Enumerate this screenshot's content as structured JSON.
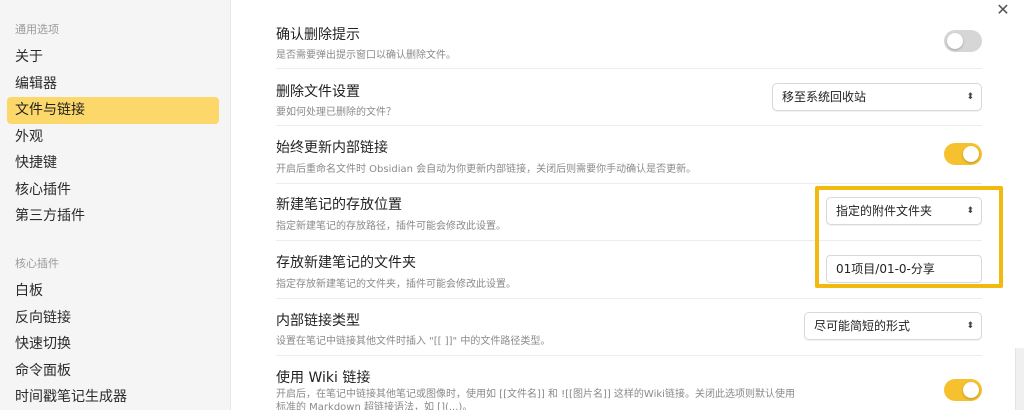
{
  "sidebar": {
    "general_title": "通用选项",
    "general_items": [
      "关于",
      "编辑器",
      "文件与链接",
      "外观",
      "快捷键",
      "核心插件",
      "第三方插件"
    ],
    "active_index": 2,
    "core_title": "核心插件",
    "core_items": [
      "白板",
      "反向链接",
      "快速切换",
      "命令面板",
      "时间戳笔记生成器"
    ]
  },
  "close_icon": "close-icon",
  "settings": [
    {
      "title": "确认删除提示",
      "desc": "是否需要弹出提示窗口以确认删除文件。",
      "control": "toggle",
      "on": false
    },
    {
      "title": "删除文件设置",
      "desc": "要如何处理已删除的文件？",
      "control": "select",
      "value": "移至系统回收站"
    },
    {
      "title": "始终更新内部链接",
      "desc": "开启后重命名文件时 Obsidian 会自动为你更新内部链接，关闭后则需要你手动确认是否更新。",
      "control": "toggle",
      "on": true
    },
    {
      "title": "新建笔记的存放位置",
      "desc": "指定新建笔记的存放路径，插件可能会修改此设置。",
      "control": "select",
      "value": "指定的附件文件夹"
    },
    {
      "title": "存放新建笔记的文件夹",
      "desc": "指定存放新建笔记的文件夹，插件可能会修改此设置。",
      "control": "text",
      "value": "01项目/01-0-分享"
    },
    {
      "title": "内部链接类型",
      "desc": "设置在笔记中链接其他文件时插入 \"[[ ]]\" 中的文件路径类型。",
      "control": "select",
      "value": "尽可能简短的形式"
    },
    {
      "title": "使用 Wiki 链接",
      "desc": "开启后，在笔记中链接其他笔记或图像时，使用如 [[文件名]] 和 ![[图片名]] 这样的Wiki链接。关闭此选项则默认使用标准的 Markdown 超链接语法，如 [](...)。",
      "control": "toggle",
      "on": true
    }
  ],
  "colors": {
    "accent": "#f5c12f",
    "highlight": "#f2b90f",
    "active_item": "#fcd86a"
  }
}
